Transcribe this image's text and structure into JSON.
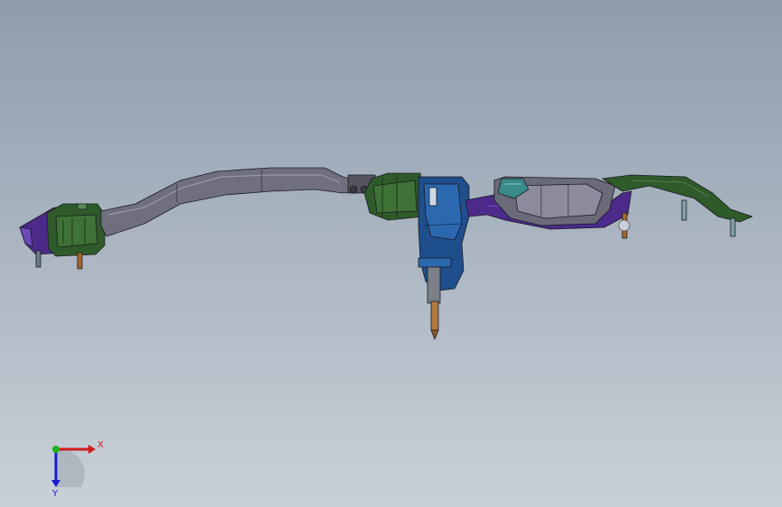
{
  "viewport": {
    "background_top": "#8e9cad",
    "background_bottom": "#c9d0d7"
  },
  "model": {
    "parts": [
      {
        "name": "left-bracket",
        "color": "#2f5a2a"
      },
      {
        "name": "left-mount-plate",
        "color": "#4b2a8a"
      },
      {
        "name": "long-arm",
        "color": "#6f6f80"
      },
      {
        "name": "center-motor-green",
        "color": "#2f5a2a"
      },
      {
        "name": "center-housing-blue",
        "color": "#1f4e8c"
      },
      {
        "name": "spindle",
        "color": "#b0793f"
      },
      {
        "name": "right-housing-gray",
        "color": "#6a6a78"
      },
      {
        "name": "right-purple-frame",
        "color": "#4b2a8a"
      },
      {
        "name": "right-green-bracket",
        "color": "#2f5a2a"
      },
      {
        "name": "teal-cover",
        "color": "#3a8a8a"
      }
    ]
  },
  "triad": {
    "x_label": "X",
    "y_label": "Y",
    "x_color": "#d11a1a",
    "y_color": "#1a1ad1",
    "origin_color": "#1db51d"
  }
}
